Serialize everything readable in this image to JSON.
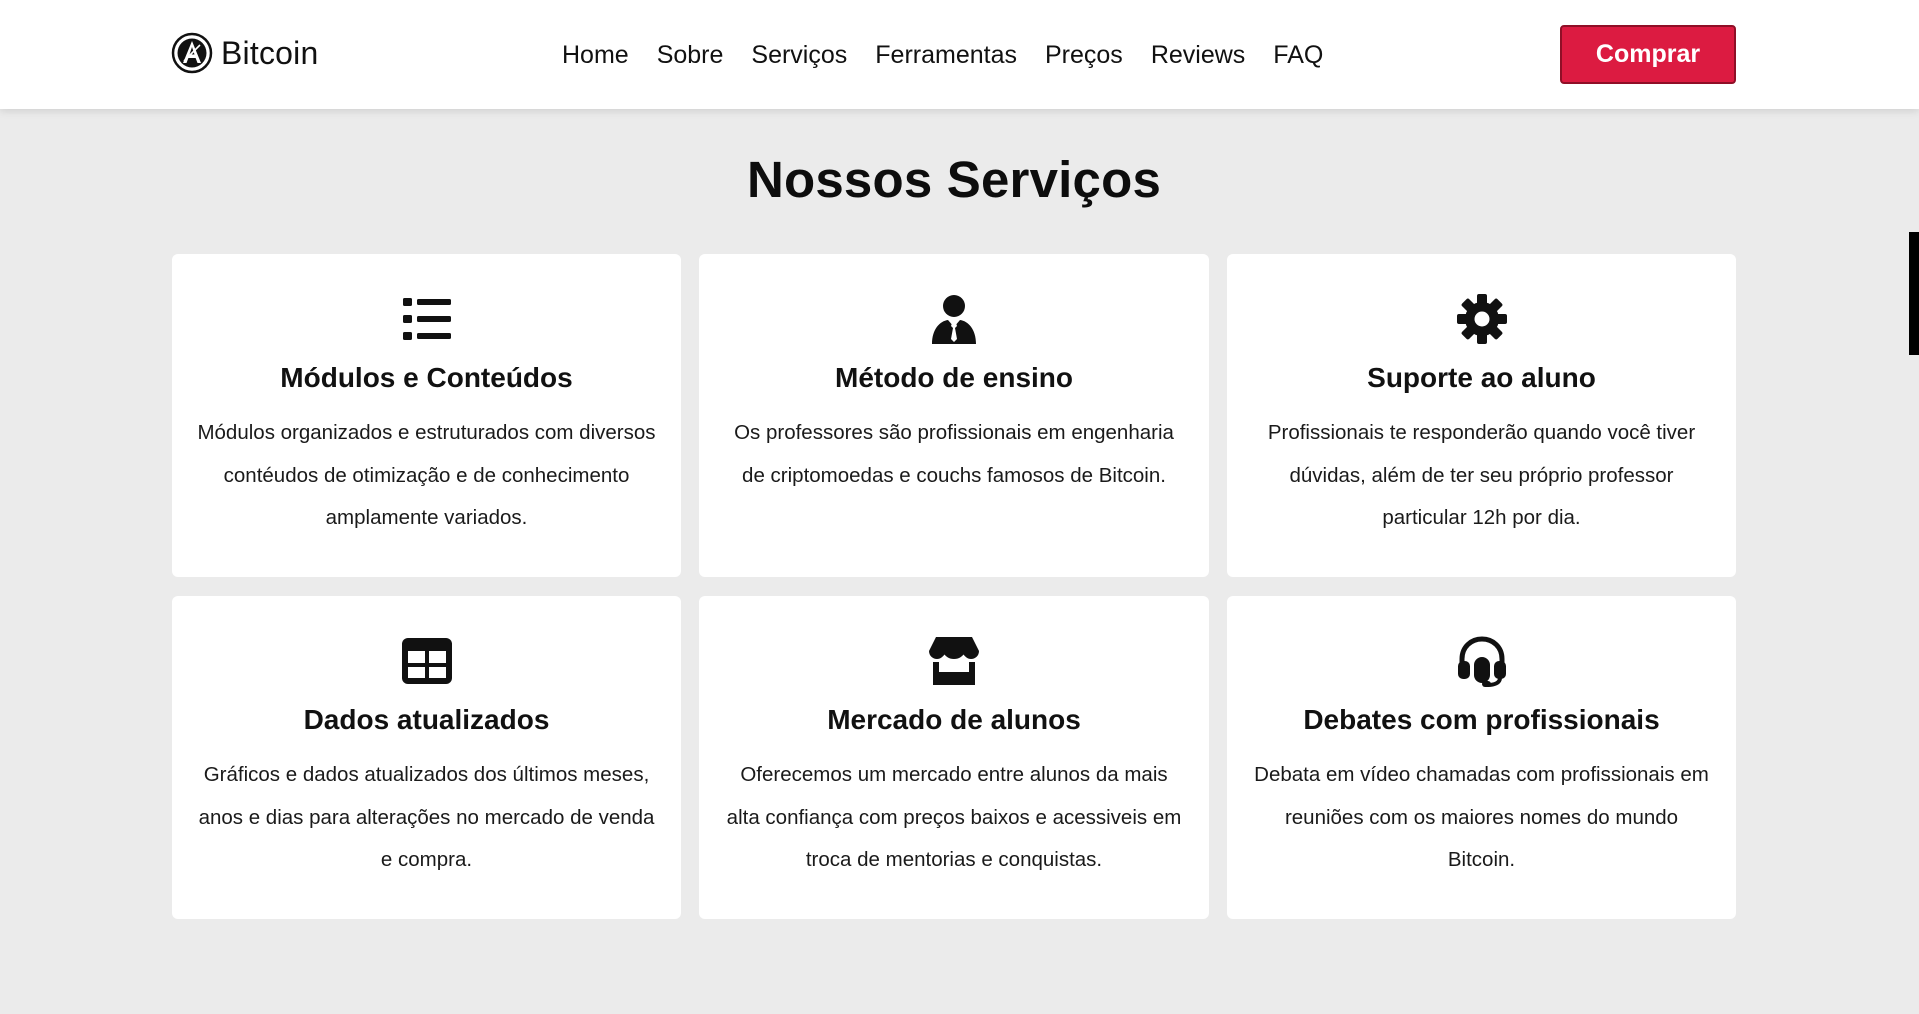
{
  "brand": {
    "name": "Bitcoin",
    "logo_icon": "bitcoin-a-logo-icon"
  },
  "nav": [
    {
      "label": "Home"
    },
    {
      "label": "Sobre"
    },
    {
      "label": "Serviços"
    },
    {
      "label": "Ferramentas"
    },
    {
      "label": "Preços"
    },
    {
      "label": "Reviews"
    },
    {
      "label": "FAQ"
    }
  ],
  "cta": {
    "label": "Comprar",
    "color": "#dc1b41"
  },
  "services": {
    "title": "Nossos Serviços",
    "cards": [
      {
        "icon": "list-icon",
        "title": "Módulos e Conteúdos",
        "text": "Módulos organizados e estruturados com diversos contéudos de otimização e de conhecimento amplamente variados."
      },
      {
        "icon": "user-tie-icon",
        "title": "Método de ensino",
        "text": "Os professores são profissionais em engenharia de criptomoedas e couchs famosos de Bitcoin."
      },
      {
        "icon": "gear-icon",
        "title": "Suporte ao aluno",
        "text": "Profissionais te responderão quando você tiver dúvidas, além de ter seu próprio professor particular 12h por dia."
      },
      {
        "icon": "table-icon",
        "title": "Dados atualizados",
        "text": "Gráficos e dados atualizados dos últimos meses, anos e dias para alterações no mercado de venda e compra."
      },
      {
        "icon": "store-icon",
        "title": "Mercado de alunos",
        "text": "Oferecemos um mercado entre alunos da mais alta confiança com preços baixos e acessiveis em troca de mentorias e conquistas."
      },
      {
        "icon": "headset-icon",
        "title": "Debates com profissionais",
        "text": "Debata em vídeo chamadas com profissionais em reuniões com os maiores nomes do mundo Bitcoin."
      }
    ]
  },
  "colors": {
    "page_background": "#ebebeb",
    "card_background": "#ffffff",
    "accent": "#dc1b41"
  }
}
